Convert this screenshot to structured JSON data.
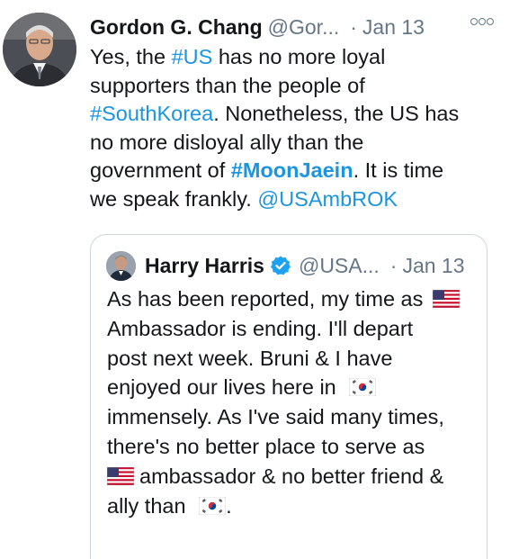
{
  "tweet": {
    "author_name": "Gordon G. Chang",
    "author_handle": "@Gor...",
    "separator": "·",
    "date": "Jan 13",
    "text": {
      "l1_a": "Yes, the ",
      "l1_tag": "#US",
      "l1_b": " has no more loyal",
      "l2": "supporters than the people of",
      "l3_tag": "#SouthKorea",
      "l3_b": ". Nonetheless, the US has",
      "l4": "no more disloyal ally than the",
      "l5_a": "government of ",
      "l5_tag": "#MoonJaein",
      "l5_b": ". It is time",
      "l6_a": "we speak frankly. ",
      "l6_mention": "@USAmbROK"
    }
  },
  "quoted": {
    "author_name": "Harry Harris",
    "author_handle": "@USA...",
    "separator": "·",
    "date": "Jan 13",
    "text": {
      "l1": "As has been reported, my time as",
      "l2": "Ambassador is ending. I'll depart",
      "l3": "post next week. Bruni & I have",
      "l4": "enjoyed our lives here in",
      "l5": "immensely. As I've said many times,",
      "l6": "there's no better place to serve as",
      "l7": "ambassador & no better friend &",
      "l8": "ally than",
      "l8_end": "."
    }
  },
  "colors": {
    "link": "#1b95e0",
    "secondary_text": "#657786",
    "border": "#ccd6dd",
    "verified": "#1da1f2"
  },
  "icons": [
    "more-options-icon",
    "verified-badge-icon",
    "us-flag-emoji",
    "south-korea-flag-emoji"
  ]
}
